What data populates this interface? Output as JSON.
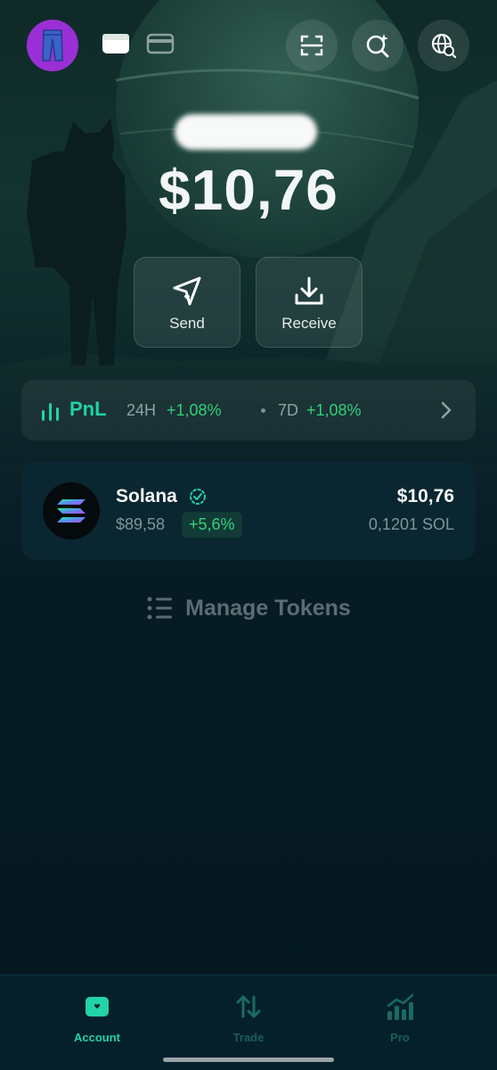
{
  "header": {
    "avatar_icon": "jeans-icon",
    "tabs": [
      {
        "name": "wallet-tab",
        "icon": "wallet-icon",
        "active": true
      },
      {
        "name": "card-tab",
        "icon": "card-icon",
        "active": false
      }
    ],
    "actions": [
      {
        "name": "scan-button",
        "icon": "scan-icon"
      },
      {
        "name": "search-button",
        "icon": "search-sparkle-icon"
      },
      {
        "name": "browser-button",
        "icon": "globe-search-icon"
      }
    ]
  },
  "balance": {
    "value": "$10,76"
  },
  "actions": {
    "send_label": "Send",
    "receive_label": "Receive"
  },
  "pnl": {
    "label": "PnL",
    "period_1": "24H",
    "change_1": "+1,08%",
    "period_2": "7D",
    "change_2": "+1,08%"
  },
  "tokens": [
    {
      "name": "Solana",
      "price": "$89,58",
      "change": "+5,6%",
      "value": "$10,76",
      "amount": "0,1201 SOL",
      "verified": true
    }
  ],
  "manage_tokens_label": "Manage Tokens",
  "nav": {
    "items": [
      {
        "label": "Account",
        "icon": "wallet-icon",
        "active": true
      },
      {
        "label": "Trade",
        "icon": "swap-arrows-icon",
        "active": false
      },
      {
        "label": "Pro",
        "icon": "chart-growth-icon",
        "active": false
      }
    ]
  },
  "colors": {
    "accent": "#21d3a6",
    "positive": "#2fd07a",
    "avatar_bg": "#9b2fd6",
    "background": "#061a22"
  }
}
